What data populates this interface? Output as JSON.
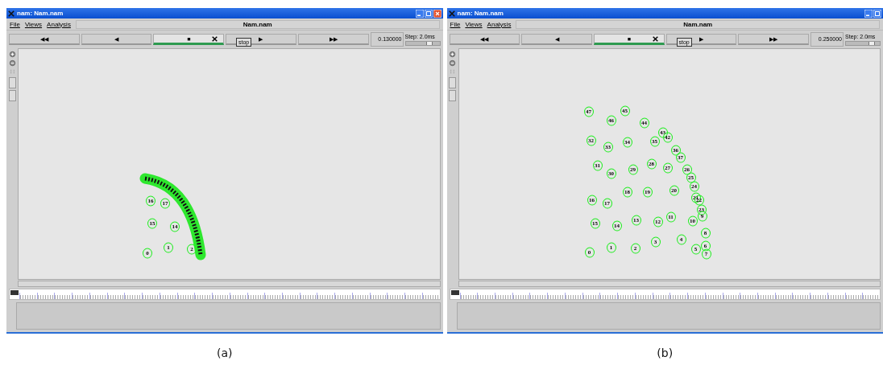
{
  "panels": [
    {
      "caption": "(a)",
      "window": {
        "title": "nam: Nam.nam",
        "buttons": [
          {
            "kind": "minimize"
          },
          {
            "kind": "maximize"
          },
          {
            "kind": "close"
          }
        ]
      },
      "menu": [
        "File",
        "Views",
        "Analysis"
      ],
      "file_name": "Nam.nam",
      "transport": [
        {
          "label": "◀◀",
          "selected": false
        },
        {
          "label": "◀",
          "selected": false
        },
        {
          "label": "■",
          "selected": true
        },
        {
          "label": "▶",
          "selected": false
        },
        {
          "label": "▶▶",
          "selected": false
        }
      ],
      "tooltip": "stop",
      "time": "0.130000",
      "step": {
        "label": "Step: 2.0ms",
        "level": 0.7
      },
      "overlapping_cluster": true,
      "nodes": [
        "16",
        "17",
        "15",
        "14",
        "0",
        "1",
        "2"
      ]
    },
    {
      "caption": "(b)",
      "window": {
        "title": "nam: Nam.nam",
        "buttons": [
          {
            "kind": "minimize"
          },
          {
            "kind": "maximize"
          }
        ]
      },
      "menu": [
        "File",
        "Views",
        "Analysis"
      ],
      "file_name": "Nam.nam",
      "transport": [
        {
          "label": "◀◀",
          "selected": false
        },
        {
          "label": "◀",
          "selected": false
        },
        {
          "label": "■",
          "selected": true
        },
        {
          "label": "▶",
          "selected": false
        },
        {
          "label": "▶▶",
          "selected": false
        }
      ],
      "tooltip": "stop",
      "time": "0.250000",
      "step": {
        "label": "Step: 2.0ms",
        "level": 0.75
      },
      "overlapping_cluster": false,
      "nodes": [
        "47",
        "45",
        "46",
        "44",
        "43",
        "42",
        "32",
        "33",
        "34",
        "35",
        "36",
        "37",
        "31",
        "30",
        "29",
        "28",
        "27",
        "26",
        "25",
        "24",
        "21",
        "22",
        "23",
        "9",
        "16",
        "17",
        "18",
        "19",
        "20",
        "15",
        "14",
        "13",
        "12",
        "11",
        "10",
        "8",
        "4",
        "3",
        "0",
        "1",
        "2",
        "5",
        "6",
        "7"
      ]
    }
  ]
}
